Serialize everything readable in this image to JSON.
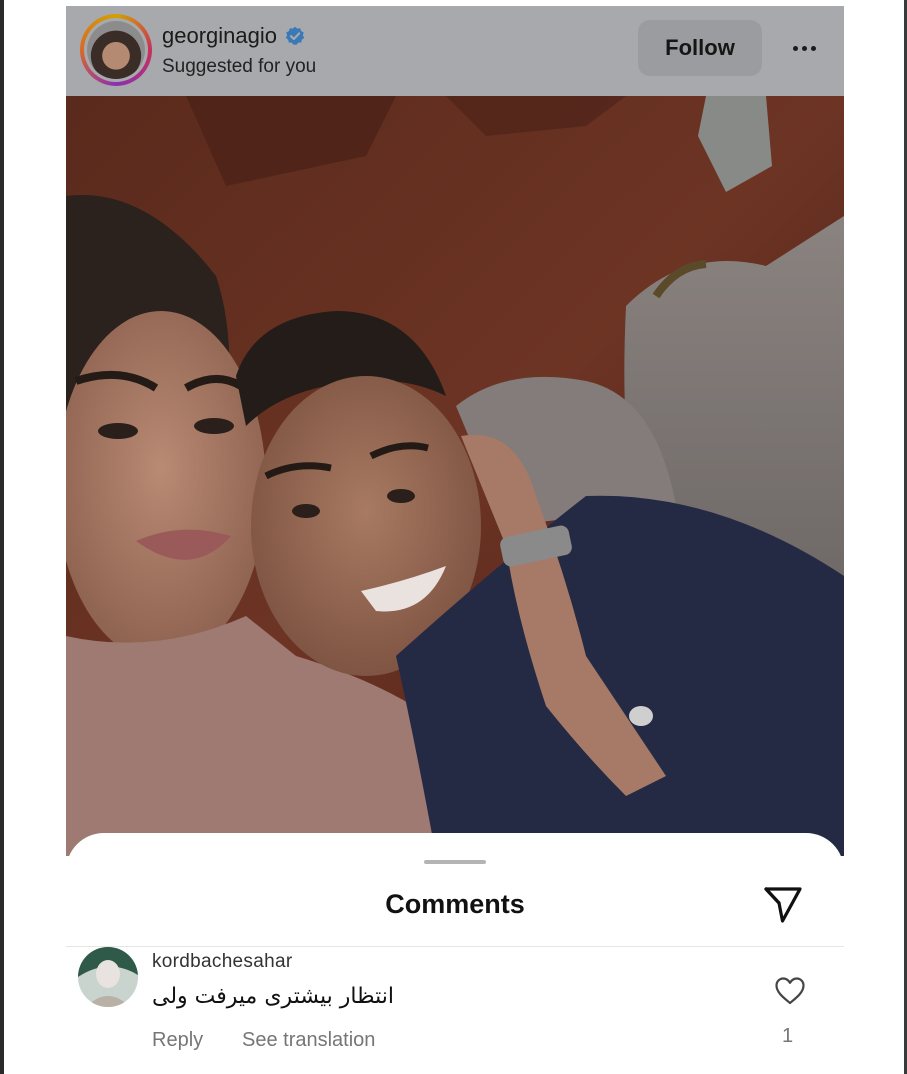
{
  "post": {
    "username": "georginagio",
    "subtitle": "Suggested for you",
    "follow_label": "Follow"
  },
  "comments_sheet": {
    "title": "Comments"
  },
  "comments": [
    {
      "username": "kordbachesahar",
      "text": "انتظار بیشتری میرفت ولی",
      "reply_label": "Reply",
      "translate_label": "See translation",
      "like_count": "1"
    }
  ],
  "colors": {
    "verified_badge": "#0095f6",
    "overlay_dim": "#a7a9ac",
    "secondary_text": "#767676"
  },
  "icons": {
    "verified": "verified-badge-icon",
    "more": "more-options-icon",
    "share": "paper-plane-icon",
    "like": "heart-outline-icon"
  }
}
